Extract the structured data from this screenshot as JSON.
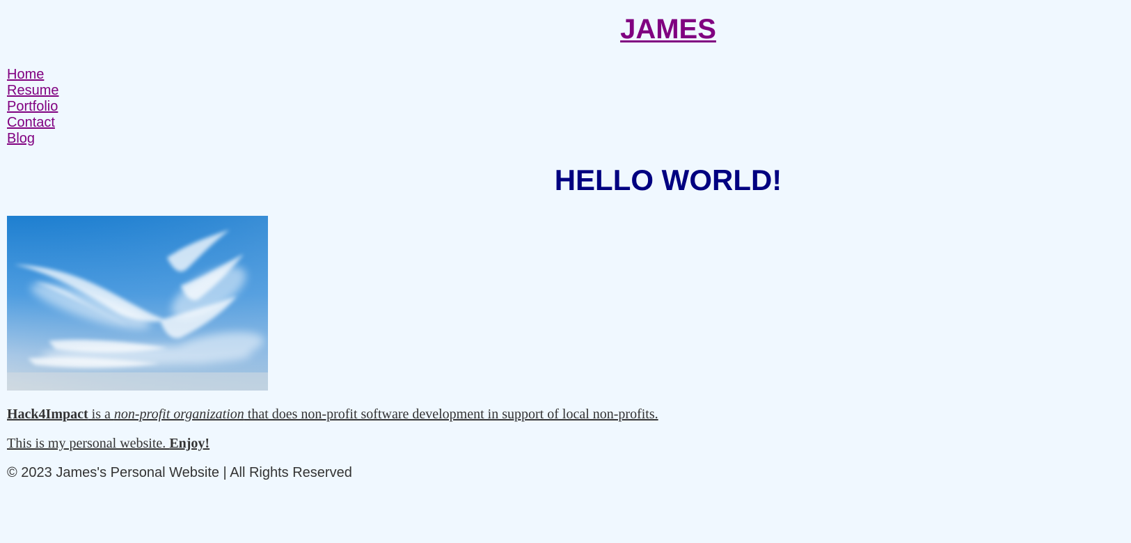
{
  "header": {
    "site_title": "JAMES"
  },
  "nav": {
    "items": [
      {
        "label": "Home"
      },
      {
        "label": "Resume"
      },
      {
        "label": "Portfolio"
      },
      {
        "label": "Contact"
      },
      {
        "label": "Blog"
      }
    ]
  },
  "main": {
    "heading": "HELLO WORLD!",
    "image": "sky-with-clouds",
    "intro": {
      "org_name": "Hack4Impact",
      "text_a": " is a ",
      "org_type": "non-profit organization",
      "text_b": " that does non-profit software development in support of local non-profits."
    },
    "personal": {
      "text": "This is my personal website. ",
      "emphasis": "Enjoy!"
    }
  },
  "footer": {
    "text": "© 2023 James's Personal Website | All Rights Reserved"
  },
  "colors": {
    "background": "#f0f8ff",
    "link": "#800080",
    "heading": "#000080",
    "body_text": "#333333"
  }
}
